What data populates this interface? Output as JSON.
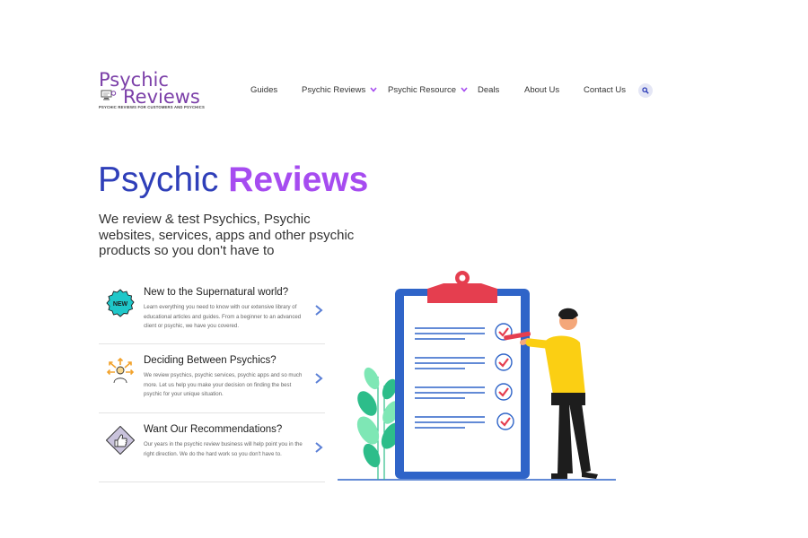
{
  "logo": {
    "line1": "Psychic",
    "line2": "Reviews",
    "tagline": "PSYCHIC REVIEWS FOR CUSTOMERS AND PSYCHICS"
  },
  "nav": {
    "items": [
      {
        "label": "Guides"
      },
      {
        "label": "Psychic Reviews",
        "has_dropdown": true
      },
      {
        "label": "Psychic Resource",
        "has_dropdown": true
      },
      {
        "label": "Deals"
      },
      {
        "label": "About Us"
      },
      {
        "label": "Contact Us"
      }
    ],
    "search_icon": "search-icon"
  },
  "hero": {
    "title_part1": "Psychic",
    "title_part2": "Reviews",
    "subtitle": "We review & test Psychics, Psychic websites, services, apps and other psychic products so you don't have to"
  },
  "features": [
    {
      "title": "New to the Supernatural world?",
      "description": "Learn everything you need to know with our extensive library of educational articles and guides. From a beginner to an advanced client or psychic, we have you covered.",
      "icon": "new-badge-icon"
    },
    {
      "title": "Deciding Between Psychics?",
      "description": "We review psychics, psychic services, psychic apps and so much more. Let us help you make your decision on finding the best psychic for your unique situation.",
      "icon": "decision-person-icon"
    },
    {
      "title": "Want Our Recommendations?",
      "description": "Our years in the psychic review business will help point you in the right direction. We do the hard work so you don't have to.",
      "icon": "thumbs-up-icon"
    }
  ],
  "colors": {
    "brand_blue": "#2f3fb9",
    "brand_purple": "#a64cf0",
    "logo_purple": "#7b3fa8",
    "arrow_blue": "#5a7fd6",
    "illustration_blue": "#2f64c8",
    "illustration_red": "#e53e4f",
    "shirt_yellow": "#fbcf13"
  }
}
